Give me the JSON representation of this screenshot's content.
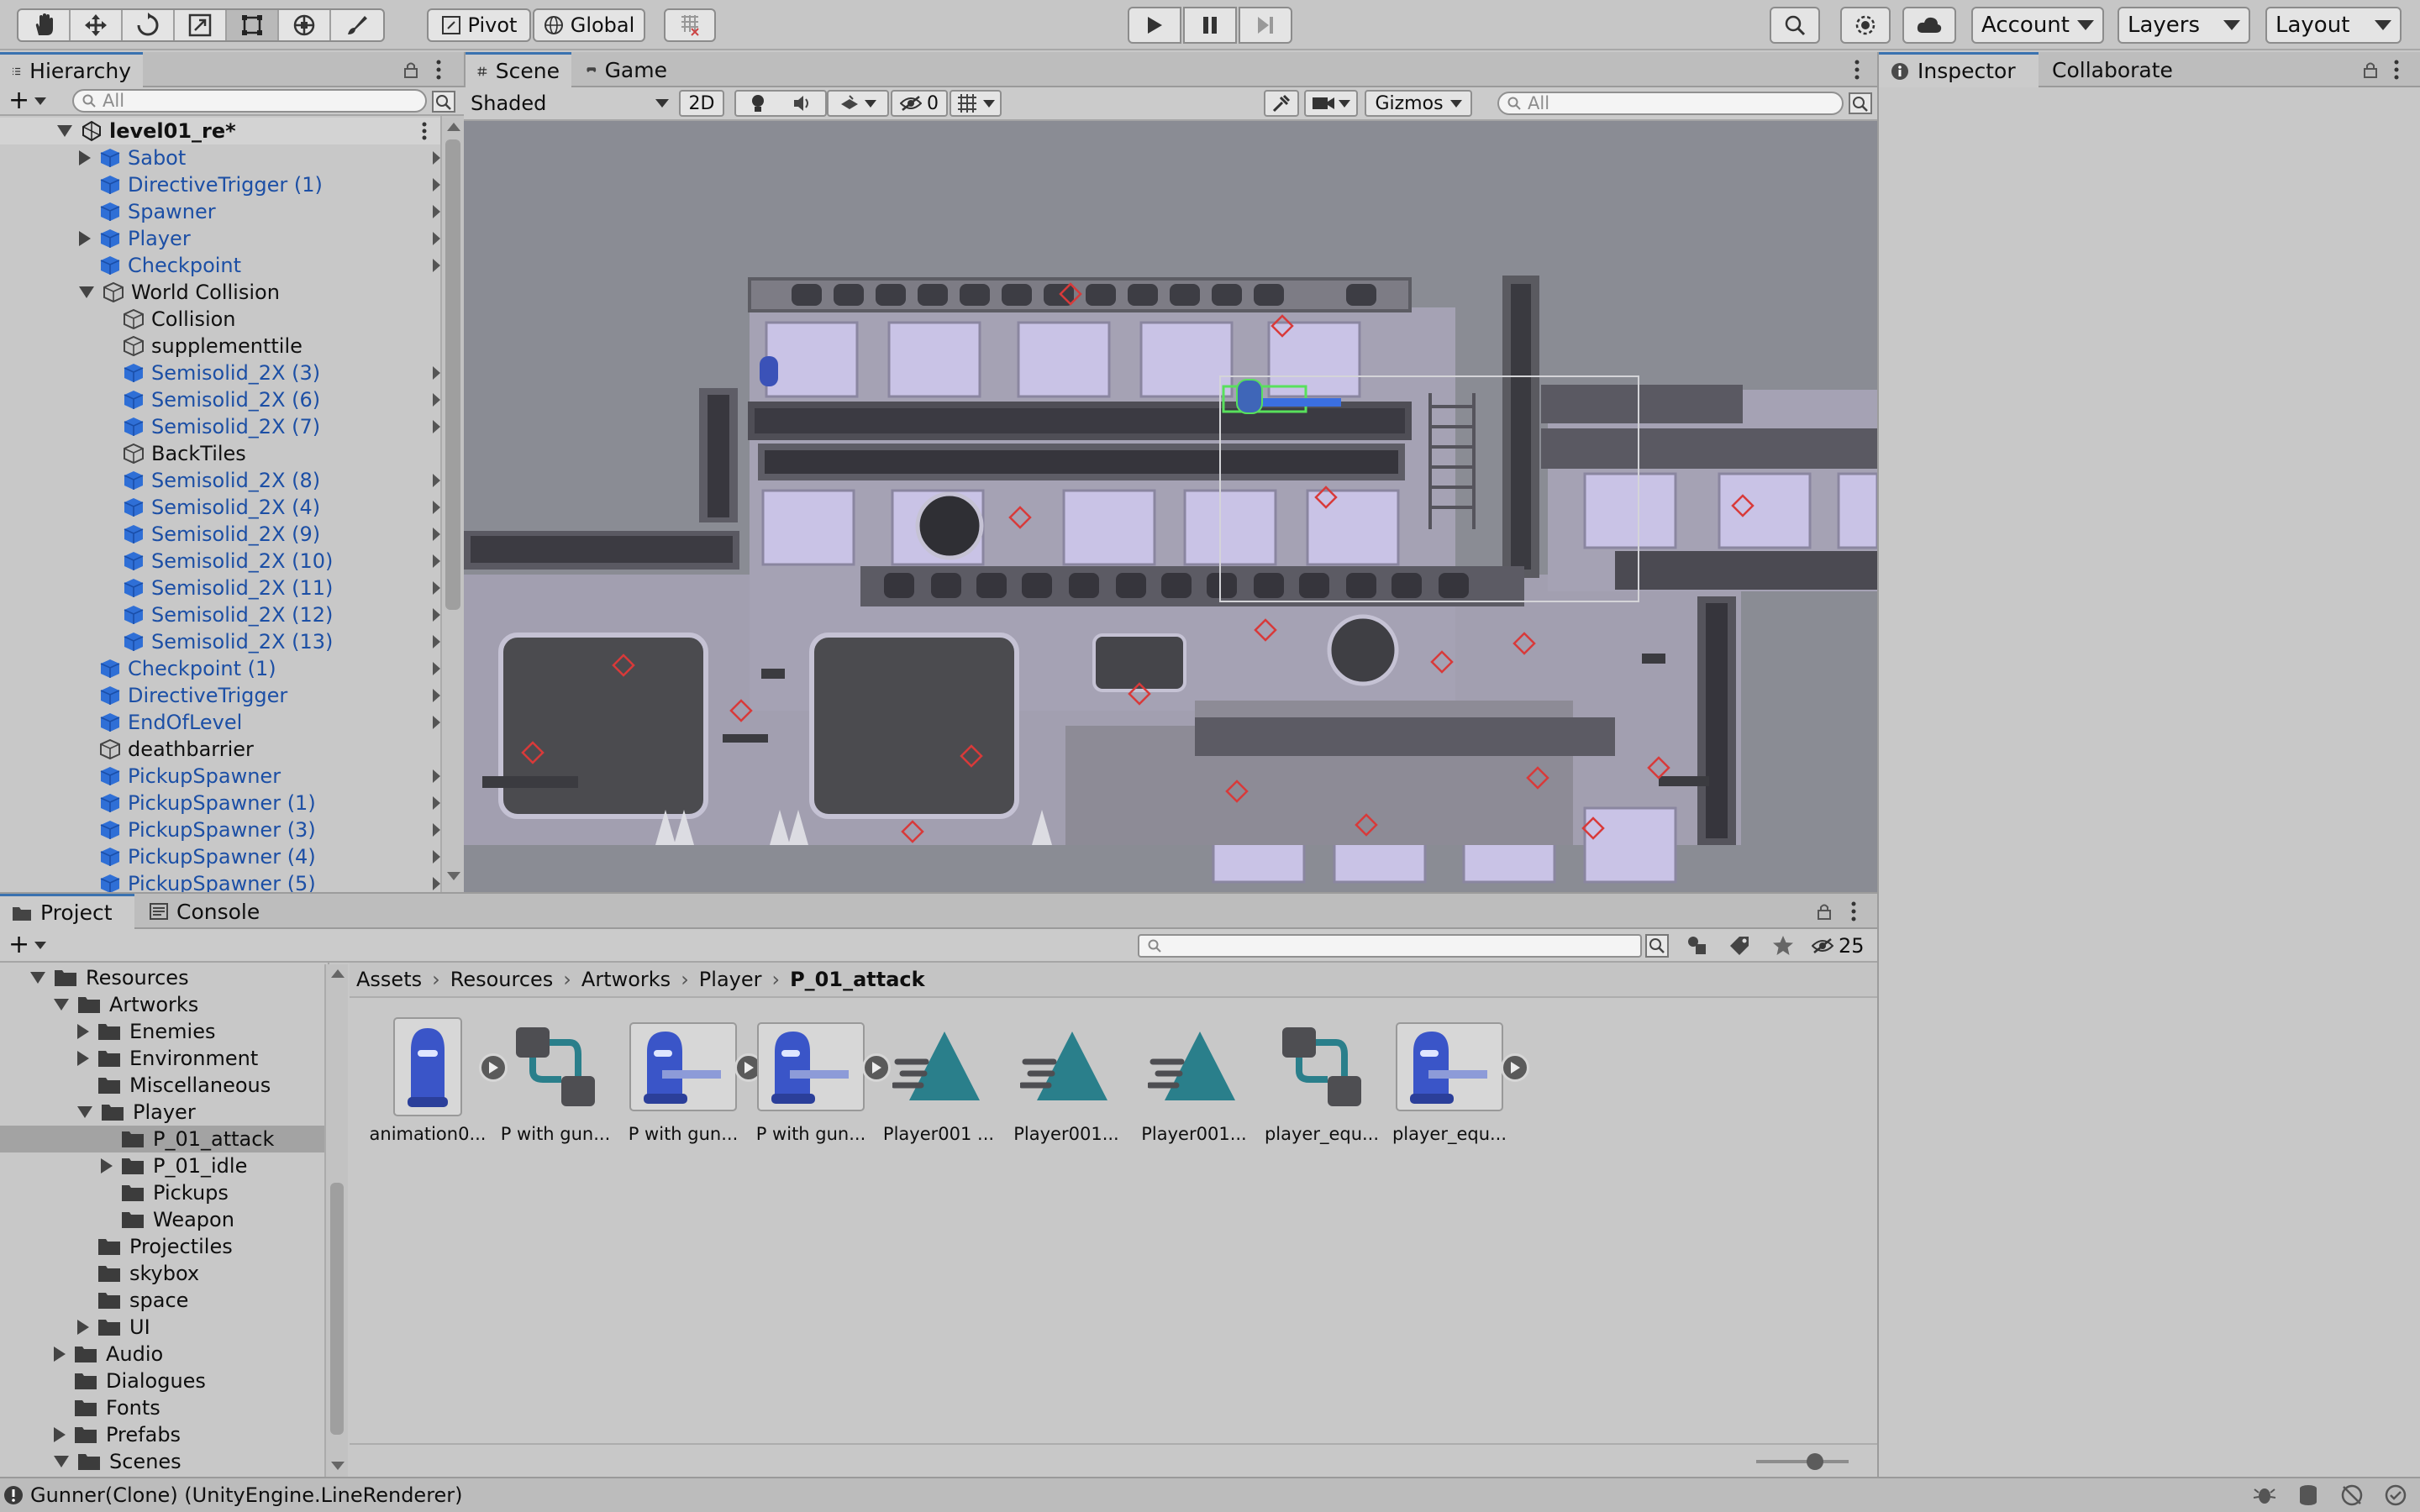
{
  "toolbar": {
    "pivot_label": "Pivot",
    "global_label": "Global",
    "account_label": "Account",
    "layers_label": "Layers",
    "layout_label": "Layout"
  },
  "hierarchy": {
    "tab_label": "Hierarchy",
    "search_placeholder": "All",
    "scene_name": "level01_re*",
    "items": [
      {
        "label": "Sabot",
        "color": "blue"
      },
      {
        "label": "DirectiveTrigger (1)",
        "color": "blue"
      },
      {
        "label": "Spawner",
        "color": "blue"
      },
      {
        "label": "Player",
        "color": "blue"
      },
      {
        "label": "Checkpoint",
        "color": "blue"
      },
      {
        "label": "World Collision",
        "color": "dark"
      },
      {
        "label": "Collision",
        "color": "dark"
      },
      {
        "label": "supplementtile",
        "color": "dark"
      },
      {
        "label": "Semisolid_2X (3)",
        "color": "blue"
      },
      {
        "label": "Semisolid_2X (6)",
        "color": "blue"
      },
      {
        "label": "Semisolid_2X (7)",
        "color": "blue"
      },
      {
        "label": "BackTiles",
        "color": "dark"
      },
      {
        "label": "Semisolid_2X (8)",
        "color": "blue"
      },
      {
        "label": "Semisolid_2X (4)",
        "color": "blue"
      },
      {
        "label": "Semisolid_2X (9)",
        "color": "blue"
      },
      {
        "label": "Semisolid_2X (10)",
        "color": "blue"
      },
      {
        "label": "Semisolid_2X (11)",
        "color": "blue"
      },
      {
        "label": "Semisolid_2X (12)",
        "color": "blue"
      },
      {
        "label": "Semisolid_2X (13)",
        "color": "blue"
      },
      {
        "label": "Checkpoint (1)",
        "color": "blue"
      },
      {
        "label": "DirectiveTrigger",
        "color": "blue"
      },
      {
        "label": "EndOfLevel",
        "color": "blue"
      },
      {
        "label": "deathbarrier",
        "color": "dark"
      },
      {
        "label": "PickupSpawner",
        "color": "blue"
      },
      {
        "label": "PickupSpawner (1)",
        "color": "blue"
      },
      {
        "label": "PickupSpawner (3)",
        "color": "blue"
      },
      {
        "label": "PickupSpawner (4)",
        "color": "blue"
      },
      {
        "label": "PickupSpawner (5)",
        "color": "blue"
      }
    ]
  },
  "scene": {
    "tab_label": "Scene",
    "game_tab_label": "Game",
    "shading_mode": "Shaded",
    "mode_2d_label": "2D",
    "hidden_count": "0",
    "gizmos_label": "Gizmos",
    "search_placeholder": "All"
  },
  "inspector": {
    "tab_label": "Inspector",
    "collab_tab_label": "Collaborate"
  },
  "project": {
    "tab_label": "Project",
    "console_tab_label": "Console",
    "hidden_count": "25",
    "breadcrumb": [
      "Assets",
      "Resources",
      "Artworks",
      "Player",
      "P_01_attack"
    ],
    "folders": [
      {
        "label": "Resources"
      },
      {
        "label": "Artworks"
      },
      {
        "label": "Enemies"
      },
      {
        "label": "Environment"
      },
      {
        "label": "Miscellaneous"
      },
      {
        "label": "Player"
      },
      {
        "label": "P_01_attack"
      },
      {
        "label": "P_01_idle"
      },
      {
        "label": "Pickups"
      },
      {
        "label": "Weapon"
      },
      {
        "label": "Projectiles"
      },
      {
        "label": "skybox"
      },
      {
        "label": "space"
      },
      {
        "label": "UI"
      },
      {
        "label": "Audio"
      },
      {
        "label": "Dialogues"
      },
      {
        "label": "Fonts"
      },
      {
        "label": "Prefabs"
      },
      {
        "label": "Scenes"
      }
    ],
    "assets": [
      {
        "name": "animation0...",
        "icon": "robot-sprite-icon"
      },
      {
        "name": "P with gun...",
        "icon": "animator-controller-icon"
      },
      {
        "name": "P with gun...",
        "icon": "robot-gun-sprite-icon"
      },
      {
        "name": "P with gun...",
        "icon": "robot-gun-sprite-icon"
      },
      {
        "name": "Player001 ...",
        "icon": "animation-clip-icon"
      },
      {
        "name": "Player001...",
        "icon": "animation-clip-icon"
      },
      {
        "name": "Player001...",
        "icon": "animation-clip-icon"
      },
      {
        "name": "player_equ...",
        "icon": "animator-controller-icon"
      },
      {
        "name": "player_equ...",
        "icon": "robot-gun-sprite-icon"
      }
    ]
  },
  "status": {
    "message": "Gunner(Clone) (UnityEngine.LineRenderer)"
  },
  "colors": {
    "accent": "#3a72b0",
    "hierarchy_blue": "#1c4fa5",
    "tile_lavender": "#c9c3e6",
    "spawn_red": "#d83a3a"
  }
}
